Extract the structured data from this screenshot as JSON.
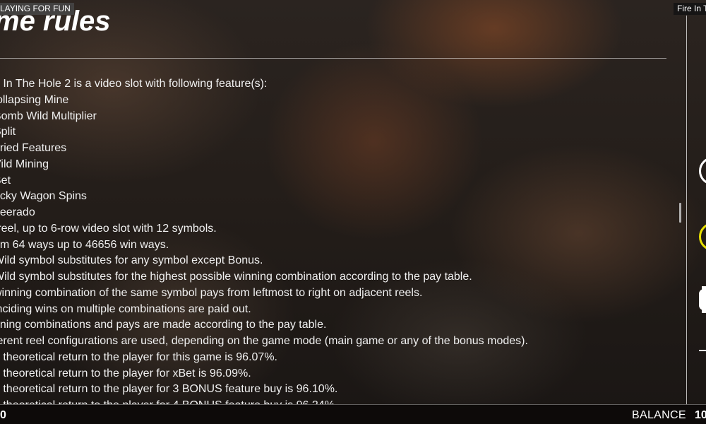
{
  "header": {
    "mode_badge": "LAYING FOR FUN",
    "game_badge": "Fire In T",
    "title": "me rules"
  },
  "rules": [
    "e In The Hole 2 is a video slot with following feature(s):",
    "ollapsing Mine",
    "Bomb Wild Multiplier",
    "Split",
    "uried Features",
    "Vild Mining",
    "Bet",
    "ucky Wagon Spins",
    "beerado",
    "-reel, up to 6-row video slot with 12 symbols.",
    "om 64 ways up to 46656 win ways.",
    "Wild symbol substitutes for any symbol except Bonus.",
    "Wild symbol substitutes for the highest possible winning combination according to the pay table.",
    "winning combination of the same symbol pays from leftmost to right on adjacent reels.",
    "inciding wins on multiple combinations are paid out.",
    "nning combinations and pays are made according to the pay table.",
    "ferent reel configurations are used, depending on the game mode (main game or any of the bonus modes).",
    "e theoretical return to the player for this game is 96.07%.",
    "e theoretical return to the player for xBet is 96.09%.",
    "e theoretical return to the player for 3 BONUS feature buy is 96.10%.",
    "e theoretical return to the player for 4 BONUS feature buy is 96.24%."
  ],
  "footer": {
    "bet_value": "0",
    "balance_label": "BALANCE",
    "balance_value": "10"
  },
  "colors": {
    "yellow_button_ring": "#e8e000",
    "white_button_ring": "#ffffff"
  }
}
